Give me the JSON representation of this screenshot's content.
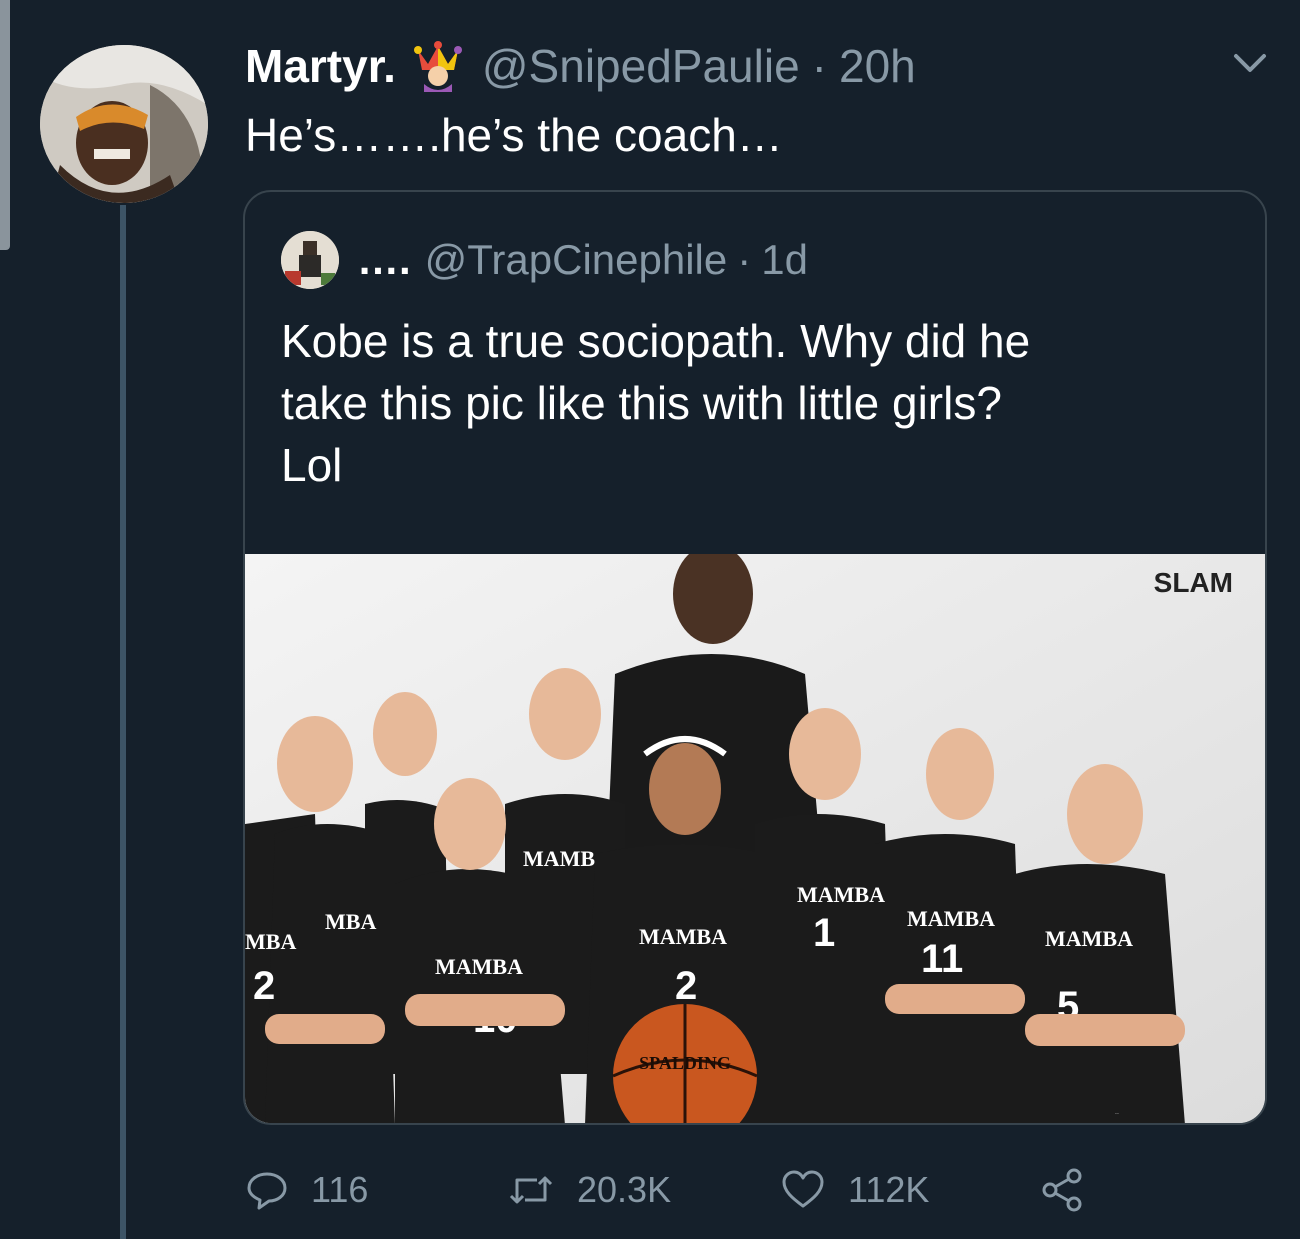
{
  "tweet": {
    "display_name": "Martyr.",
    "badge_icon": "jester-emoji-icon",
    "handle": "@SnipedPaulie",
    "separator": "·",
    "time": "20h",
    "text": "He’s…….he’s the coach…",
    "menu_icon": "chevron-down-icon"
  },
  "quoted": {
    "display_name": "….",
    "handle": "@TrapCinephile",
    "separator": "·",
    "time": "1d",
    "text_lines": [
      "Kobe is a true sociopath. Why did he",
      "take this pic like this with little girls?",
      "Lol"
    ],
    "image": {
      "watermark": "SLAM",
      "jersey_labels": [
        "MBA",
        "MBA",
        "MAMB",
        "MAMBA",
        "MAMBA",
        "MAMBA",
        "MAMBA",
        "MAMBA",
        "MAMBA"
      ],
      "jersey_numbers": [
        "2",
        "10",
        "2",
        "1",
        "11",
        "5"
      ],
      "ball_text": "SPALDING"
    }
  },
  "actions": {
    "reply_count": "116",
    "retweet_count": "20.3K",
    "like_count": "112K",
    "icons": [
      "reply-icon",
      "retweet-icon",
      "like-icon",
      "share-icon"
    ]
  },
  "colors": {
    "background": "#15202b",
    "secondary_text": "#8899a6",
    "border": "#38444d"
  }
}
